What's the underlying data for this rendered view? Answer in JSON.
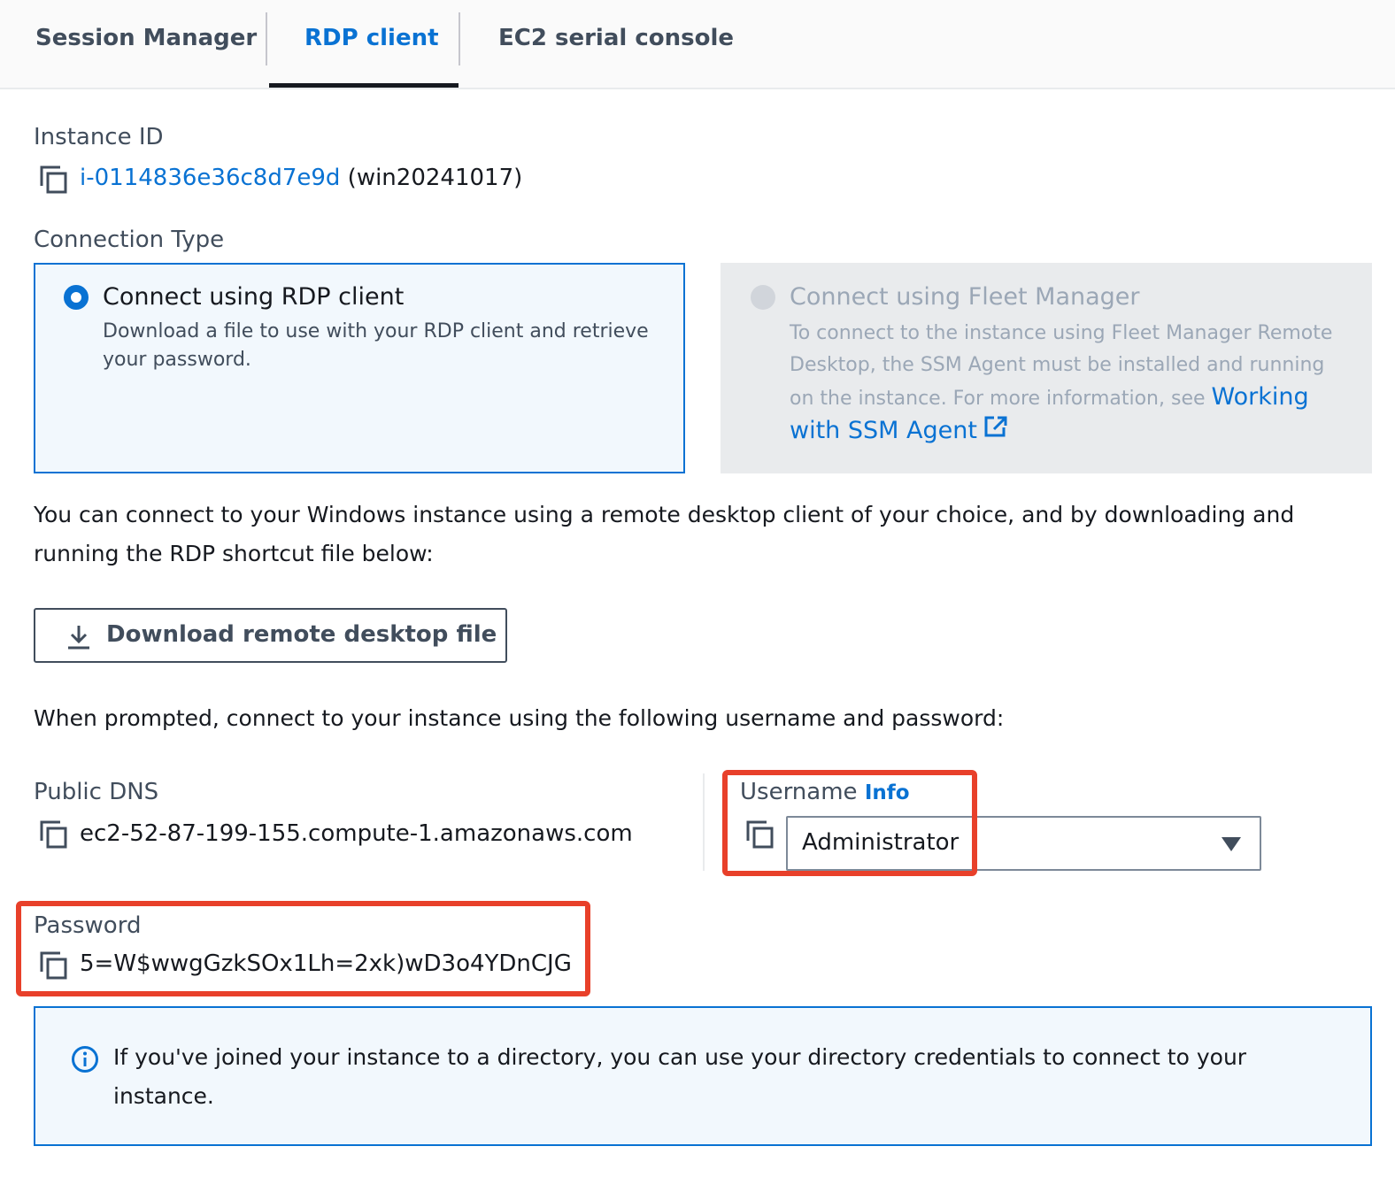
{
  "tabs": [
    {
      "label": "Session Manager",
      "active": false
    },
    {
      "label": "RDP client",
      "active": true
    },
    {
      "label": "EC2 serial console",
      "active": false
    }
  ],
  "instance": {
    "label": "Instance ID",
    "id": "i-0114836e36c8d7e9d",
    "name": "(win20241017)"
  },
  "connection_type": {
    "label": "Connection Type",
    "options": [
      {
        "title": "Connect using RDP client",
        "description": "Download a file to use with your RDP client and retrieve your password.",
        "selected": true,
        "disabled": false
      },
      {
        "title": "Connect using Fleet Manager",
        "description": "To connect to the instance using Fleet Manager Remote Desktop, the SSM Agent must be installed and running on the instance. For more information, see",
        "link": "Working with SSM Agent",
        "selected": false,
        "disabled": true
      }
    ]
  },
  "intro": "You can connect to your Windows instance using a remote desktop client of your choice, and by downloading and running the RDP shortcut file below:",
  "download_button": "Download remote desktop file",
  "prompt": "When prompted, connect to your instance using the following username and password:",
  "public_dns": {
    "label": "Public DNS",
    "value": "ec2-52-87-199-155.compute-1.amazonaws.com"
  },
  "username": {
    "label": "Username",
    "info": "Info",
    "value": "Administrator"
  },
  "password": {
    "label": "Password",
    "value": "5=W$wwgGzkSOx1Lh=2xk)wD3o4YDnCJG"
  },
  "alert": "If you've joined your instance to a directory, you can use your directory credentials to connect to your instance.",
  "colors": {
    "accent": "#0972d3",
    "highlight": "#e8402a"
  }
}
